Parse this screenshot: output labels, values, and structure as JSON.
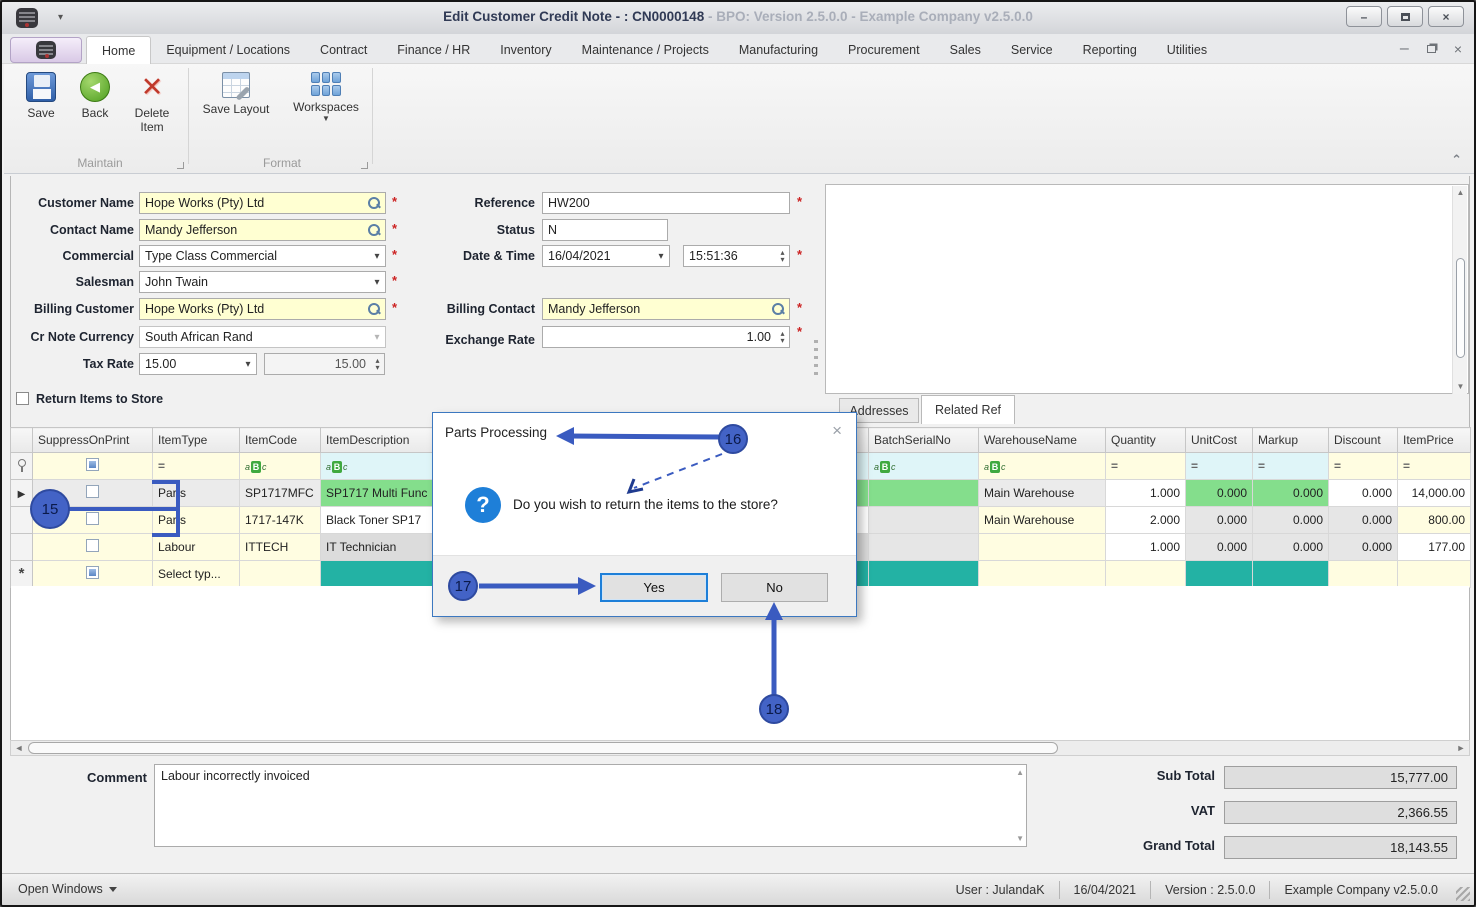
{
  "window": {
    "title": "Edit Customer Credit Note - : CN0000148",
    "title_suffix": " - BPO: Version 2.5.0.0 - Example Company v2.5.0.0"
  },
  "ribbon": {
    "tabs": [
      "Home",
      "Equipment / Locations",
      "Contract",
      "Finance / HR",
      "Inventory",
      "Maintenance / Projects",
      "Manufacturing",
      "Procurement",
      "Sales",
      "Service",
      "Reporting",
      "Utilities"
    ],
    "toolbar": {
      "save": "Save",
      "back": "Back",
      "delete_item": "Delete Item",
      "save_layout": "Save Layout",
      "workspaces": "Workspaces",
      "group_maintain": "Maintain",
      "group_format": "Format"
    }
  },
  "form": {
    "required_marker": "*",
    "customer_name": {
      "label": "Customer Name",
      "value": "Hope Works (Pty) Ltd"
    },
    "contact_name": {
      "label": "Contact Name",
      "value": "Mandy Jefferson"
    },
    "commercial": {
      "label": "Commercial",
      "value": "Type Class Commercial"
    },
    "salesman": {
      "label": "Salesman",
      "value": "John Twain"
    },
    "billing_customer": {
      "label": "Billing Customer",
      "value": "Hope Works (Pty) Ltd"
    },
    "cr_note_currency": {
      "label": "Cr Note Currency",
      "value": "South African Rand"
    },
    "tax_rate": {
      "label": "Tax Rate",
      "value": "15.00",
      "value2": "15.00"
    },
    "reference": {
      "label": "Reference",
      "value": "HW200"
    },
    "status": {
      "label": "Status",
      "value": "N"
    },
    "date_time": {
      "label": "Date & Time",
      "date": "16/04/2021",
      "time": "15:51:36"
    },
    "billing_contact": {
      "label": "Billing Contact",
      "value": "Mandy Jefferson"
    },
    "exchange_rate": {
      "label": "Exchange Rate",
      "value": "1.00"
    }
  },
  "return_items": {
    "label": "Return Items to Store"
  },
  "panel_tabs": {
    "addresses": "Addresses",
    "related_ref": "Related Ref"
  },
  "grid": {
    "columns": {
      "suppress": "SuppressOnPrint",
      "item_type": "ItemType",
      "item_code": "ItemCode",
      "item_description": "ItemDescription",
      "batch_serial": "BatchSerialNo",
      "warehouse": "WarehouseName",
      "quantity": "Quantity",
      "unit_cost": "UnitCost",
      "markup": "Markup",
      "discount": "Discount",
      "item_price": "ItemPrice"
    },
    "filter": {
      "equals": "=",
      "abc_a": "a",
      "abc_b": "B",
      "abc_c": "c"
    },
    "current_row_marker": "▶",
    "new_row_marker": "*",
    "rows": [
      {
        "item_type": "Parts",
        "item_code": "SP1717MFC",
        "item_description": "SP1717 Multi Func",
        "warehouse": "Main Warehouse",
        "quantity": "1.000",
        "unit_cost": "0.000",
        "markup": "0.000",
        "discount": "0.000",
        "item_price": "14,000.00"
      },
      {
        "item_type": "Parts",
        "item_code": "1717-147K",
        "item_description": "Black Toner SP17",
        "warehouse": "Main Warehouse",
        "quantity": "2.000",
        "unit_cost": "0.000",
        "markup": "0.000",
        "discount": "0.000",
        "item_price": "800.00"
      },
      {
        "item_type": "Labour",
        "item_code": "ITTECH",
        "item_description": "IT Technician",
        "warehouse": "",
        "quantity": "1.000",
        "unit_cost": "0.000",
        "markup": "0.000",
        "discount": "0.000",
        "item_price": "177.00"
      },
      {
        "item_type": "Select typ...",
        "item_code": "",
        "item_description": "",
        "warehouse": "",
        "quantity": "",
        "unit_cost": "",
        "markup": "",
        "discount": "",
        "item_price": ""
      }
    ]
  },
  "dialog": {
    "title": "Parts Processing",
    "close": "×",
    "question_mark": "?",
    "message": "Do you wish to return the items to the store?",
    "yes": "Yes",
    "no": "No"
  },
  "callouts": {
    "c15": "15",
    "c16": "16",
    "c17": "17",
    "c18": "18"
  },
  "comment": {
    "label": "Comment",
    "value": "Labour incorrectly invoiced"
  },
  "totals": {
    "sub_total": {
      "label": "Sub Total",
      "value": "15,777.00"
    },
    "vat": {
      "label": "VAT",
      "value": "2,366.55"
    },
    "grand_total": {
      "label": "Grand Total",
      "value": "18,143.55"
    }
  },
  "statusbar": {
    "open_windows": "Open Windows",
    "user": "User : JulandaK",
    "date": "16/04/2021",
    "version": "Version : 2.5.0.0",
    "company": "Example Company v2.5.0.0"
  },
  "colors": {
    "callout_blue": "#4363C6",
    "arrow_blue": "#3A5BC0",
    "green_cell": "#84DE8C",
    "teal_cell": "#23B2A4",
    "yellow_field": "#FFFFD2",
    "dialog_border": "#3C78C0",
    "focus_button_border": "#1E7FD8"
  }
}
